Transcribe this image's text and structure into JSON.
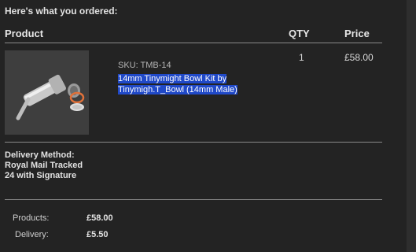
{
  "intro_text": "Here's what you ordered:",
  "table": {
    "headers": {
      "product": "Product",
      "qty": "QTY",
      "price": "Price"
    },
    "items": [
      {
        "sku": "SKU: TMB-14",
        "name": "14mm Tinymight Bowl Kit by Tinymigh.T_Bowl (14mm Male)",
        "qty": "1",
        "price": "£58.00",
        "image_icon": "tinymight-bowl-kit-photo"
      }
    ]
  },
  "delivery_method": "Delivery Method: Royal Mail Tracked 24 with Signature",
  "totals": [
    {
      "label": "Products:",
      "value": "£58.00"
    },
    {
      "label": "Delivery:",
      "value": "£5.50"
    }
  ],
  "colors": {
    "background": "#232323",
    "selection": "#2049c8",
    "rule": "#8a8a8a"
  }
}
